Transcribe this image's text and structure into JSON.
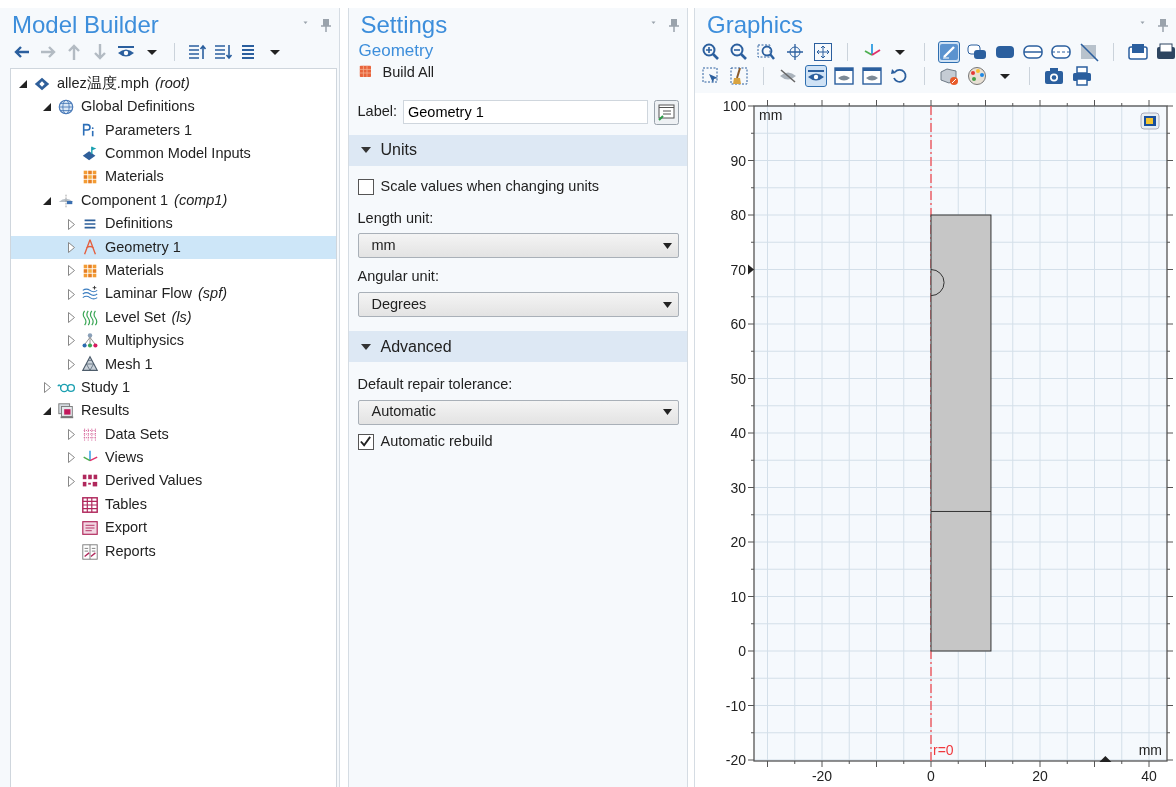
{
  "model_builder": {
    "title": "Model Builder",
    "toolbar": [
      {
        "kind": "arrow-left",
        "disabled": false
      },
      {
        "kind": "arrow-right",
        "disabled": true
      },
      {
        "kind": "arrow-up",
        "disabled": true
      },
      {
        "kind": "arrow-down",
        "disabled": true
      },
      {
        "kind": "eye",
        "disabled": false
      },
      {
        "kind": "caret",
        "disabled": false
      },
      {
        "kind": "list-up",
        "disabled": false
      },
      {
        "kind": "list-down",
        "disabled": false
      },
      {
        "kind": "list",
        "disabled": false
      },
      {
        "kind": "caret",
        "disabled": false
      }
    ],
    "tree": [
      {
        "label": "allez温度.mph",
        "tag": "(root)",
        "kind": "model",
        "expanded": true,
        "selected": false,
        "children": [
          {
            "label": "Global Definitions",
            "kind": "globe",
            "expanded": true,
            "selected": false,
            "children": [
              {
                "label": "Parameters 1",
                "kind": "params",
                "selected": false
              },
              {
                "label": "Common Model Inputs",
                "kind": "inputs",
                "selected": false
              },
              {
                "label": "Materials",
                "kind": "materials",
                "selected": false
              }
            ]
          },
          {
            "label": "Component 1",
            "tag": "(comp1)",
            "kind": "component",
            "expanded": true,
            "selected": false,
            "children": [
              {
                "label": "Definitions",
                "kind": "defs",
                "expanded": false,
                "selected": false
              },
              {
                "label": "Geometry 1",
                "kind": "geometry",
                "expanded": false,
                "selected": true
              },
              {
                "label": "Materials",
                "kind": "materials",
                "expanded": false,
                "selected": false
              },
              {
                "label": "Laminar Flow",
                "tag": "(spf)",
                "kind": "flow",
                "expanded": false,
                "selected": false
              },
              {
                "label": "Level Set",
                "tag": "(ls)",
                "kind": "levelset",
                "expanded": false,
                "selected": false
              },
              {
                "label": "Multiphysics",
                "kind": "multiphysics",
                "expanded": false,
                "selected": false
              },
              {
                "label": "Mesh 1",
                "kind": "mesh",
                "expanded": false,
                "selected": false
              }
            ]
          },
          {
            "label": "Study 1",
            "kind": "study",
            "expanded": false,
            "selected": false
          },
          {
            "label": "Results",
            "kind": "results",
            "expanded": true,
            "selected": false,
            "children": [
              {
                "label": "Data Sets",
                "kind": "datasets",
                "expanded": false,
                "selected": false
              },
              {
                "label": "Views",
                "kind": "views",
                "expanded": false,
                "selected": false
              },
              {
                "label": "Derived Values",
                "kind": "derived",
                "expanded": false,
                "selected": false
              },
              {
                "label": "Tables",
                "kind": "tables",
                "selected": false
              },
              {
                "label": "Export",
                "kind": "export",
                "selected": false
              },
              {
                "label": "Reports",
                "kind": "reports",
                "selected": false
              }
            ]
          }
        ]
      }
    ]
  },
  "settings": {
    "title": "Settings",
    "subtitle": "Geometry",
    "build_button": "Build All",
    "label_field": {
      "label": "Label:",
      "value": "Geometry 1"
    },
    "sections": [
      {
        "title": "Units",
        "expanded": true,
        "items": [
          {
            "kind": "checkbox",
            "label": "Scale values when changing units",
            "checked": false
          },
          {
            "kind": "select",
            "label": "Length unit:",
            "value": "mm"
          },
          {
            "kind": "select",
            "label": "Angular unit:",
            "value": "Degrees"
          }
        ]
      },
      {
        "title": "Advanced",
        "expanded": true,
        "items": [
          {
            "kind": "select",
            "label": "Default repair tolerance:",
            "value": "Automatic"
          },
          {
            "kind": "checkbox",
            "label": "Automatic rebuild",
            "checked": true
          }
        ]
      }
    ]
  },
  "graphics": {
    "title": "Graphics",
    "toolbar_rows": [
      [
        {
          "kind": "zoom-in",
          "pressed": false
        },
        {
          "kind": "zoom-out",
          "pressed": false
        },
        {
          "kind": "zoom-box",
          "pressed": false
        },
        {
          "kind": "move",
          "pressed": false
        },
        {
          "kind": "fit",
          "pressed": false
        },
        {
          "kind": "separator"
        },
        {
          "kind": "axes",
          "pressed": false
        },
        {
          "kind": "caret",
          "pressed": false
        },
        {
          "kind": "separator"
        },
        {
          "kind": "pencil",
          "pressed": true
        },
        {
          "kind": "layers",
          "pressed": false
        },
        {
          "kind": "rounded-rect",
          "pressed": false
        },
        {
          "kind": "split-rect",
          "pressed": false
        },
        {
          "kind": "dashed-rect",
          "pressed": false
        },
        {
          "kind": "slash-square",
          "pressed": false
        },
        {
          "kind": "separator"
        },
        {
          "kind": "window",
          "pressed": false
        },
        {
          "kind": "window-dark",
          "pressed": false
        }
      ],
      [
        {
          "kind": "select-box",
          "pressed": false
        },
        {
          "kind": "broom",
          "pressed": false
        },
        {
          "kind": "separator"
        },
        {
          "kind": "eye-off",
          "pressed": false
        },
        {
          "kind": "eye",
          "pressed": true
        },
        {
          "kind": "eye-box",
          "pressed": false
        },
        {
          "kind": "eye-box",
          "pressed": false
        },
        {
          "kind": "undo",
          "pressed": false
        },
        {
          "kind": "separator"
        },
        {
          "kind": "cube",
          "pressed": false
        },
        {
          "kind": "palette",
          "pressed": false
        },
        {
          "kind": "caret",
          "pressed": false
        },
        {
          "kind": "separator"
        },
        {
          "kind": "camera",
          "pressed": false
        },
        {
          "kind": "printer",
          "pressed": false
        }
      ]
    ],
    "y_ticks": [
      "100",
      "90",
      "80",
      "70",
      "60",
      "50",
      "40",
      "30",
      "20",
      "10",
      "0",
      "-10",
      "-20"
    ],
    "x_ticks": [
      "-20",
      "0",
      "20",
      "40"
    ],
    "unit_top": "mm",
    "unit_bottom": "mm",
    "axis_label": "r=0"
  }
}
